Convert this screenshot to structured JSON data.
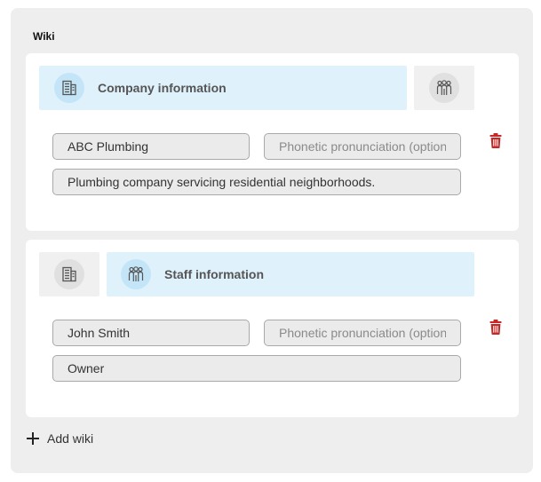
{
  "wiki": {
    "title": "Wiki",
    "add_label": "Add wiki"
  },
  "entries": [
    {
      "active_tab": "company",
      "tabs": {
        "company": {
          "label": "Company information",
          "icon": "building-icon"
        },
        "staff": {
          "label": "Staff information",
          "icon": "people-icon"
        }
      },
      "name_value": "ABC Plumbing",
      "phonetic_placeholder": "Phonetic pronunciation (optional)",
      "description_value": "Plumbing company servicing residential neighborhoods."
    },
    {
      "active_tab": "staff",
      "tabs": {
        "company": {
          "label": "Company information",
          "icon": "building-icon"
        },
        "staff": {
          "label": "Staff information",
          "icon": "people-icon"
        }
      },
      "name_value": "John Smith",
      "phonetic_placeholder": "Phonetic pronunciation (optional)",
      "description_value": "Owner"
    }
  ],
  "colors": {
    "active_tab_bg": "#dff2fc",
    "inactive_tab_bg": "#f0f0f0",
    "delete_icon": "#c62828",
    "panel_bg": "#eeeeee"
  }
}
